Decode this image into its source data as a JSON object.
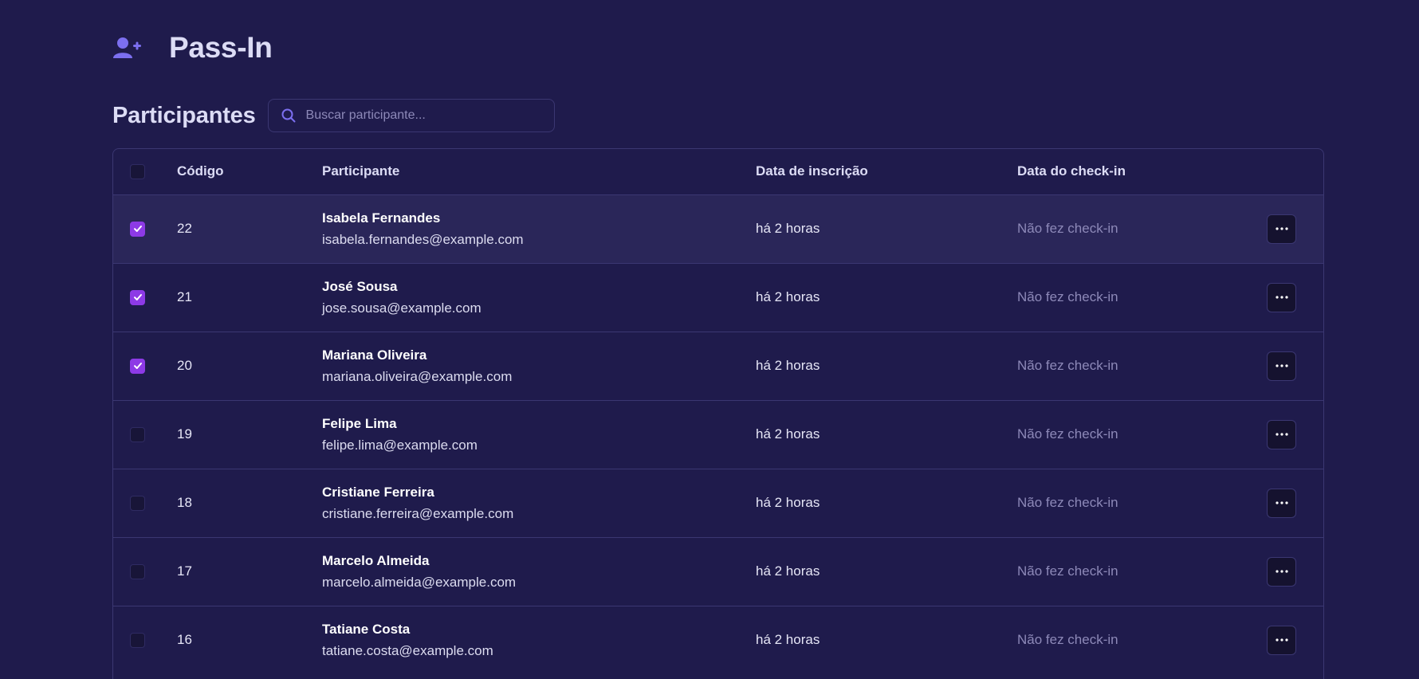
{
  "header": {
    "brand": "Pass-In",
    "brand_icon": "user-plus-icon"
  },
  "section": {
    "title": "Participantes"
  },
  "search": {
    "placeholder": "Buscar participante...",
    "value": "",
    "icon": "search-icon"
  },
  "table": {
    "columns": {
      "code": "Código",
      "participant": "Participante",
      "registration_date": "Data de inscrição",
      "checkin_date": "Data do check-in"
    },
    "rows": [
      {
        "selected": true,
        "code": "22",
        "name": "Isabela Fernandes",
        "email": "isabela.fernandes@example.com",
        "registered": "há 2 horas",
        "checkin": "Não fez check-in"
      },
      {
        "selected": true,
        "code": "21",
        "name": "José Sousa",
        "email": "jose.sousa@example.com",
        "registered": "há 2 horas",
        "checkin": "Não fez check-in"
      },
      {
        "selected": true,
        "code": "20",
        "name": "Mariana Oliveira",
        "email": "mariana.oliveira@example.com",
        "registered": "há 2 horas",
        "checkin": "Não fez check-in"
      },
      {
        "selected": false,
        "code": "19",
        "name": "Felipe Lima",
        "email": "felipe.lima@example.com",
        "registered": "há 2 horas",
        "checkin": "Não fez check-in"
      },
      {
        "selected": false,
        "code": "18",
        "name": "Cristiane Ferreira",
        "email": "cristiane.ferreira@example.com",
        "registered": "há 2 horas",
        "checkin": "Não fez check-in"
      },
      {
        "selected": false,
        "code": "17",
        "name": "Marcelo Almeida",
        "email": "marcelo.almeida@example.com",
        "registered": "há 2 horas",
        "checkin": "Não fez check-in"
      },
      {
        "selected": false,
        "code": "16",
        "name": "Tatiane Costa",
        "email": "tatiane.costa@example.com",
        "registered": "há 2 horas",
        "checkin": "Não fez check-in"
      }
    ]
  },
  "colors": {
    "background": "#1f1b4c",
    "accent": "#8d3ae6",
    "icon_accent": "#7c6ff0",
    "border": "#3b3772"
  }
}
